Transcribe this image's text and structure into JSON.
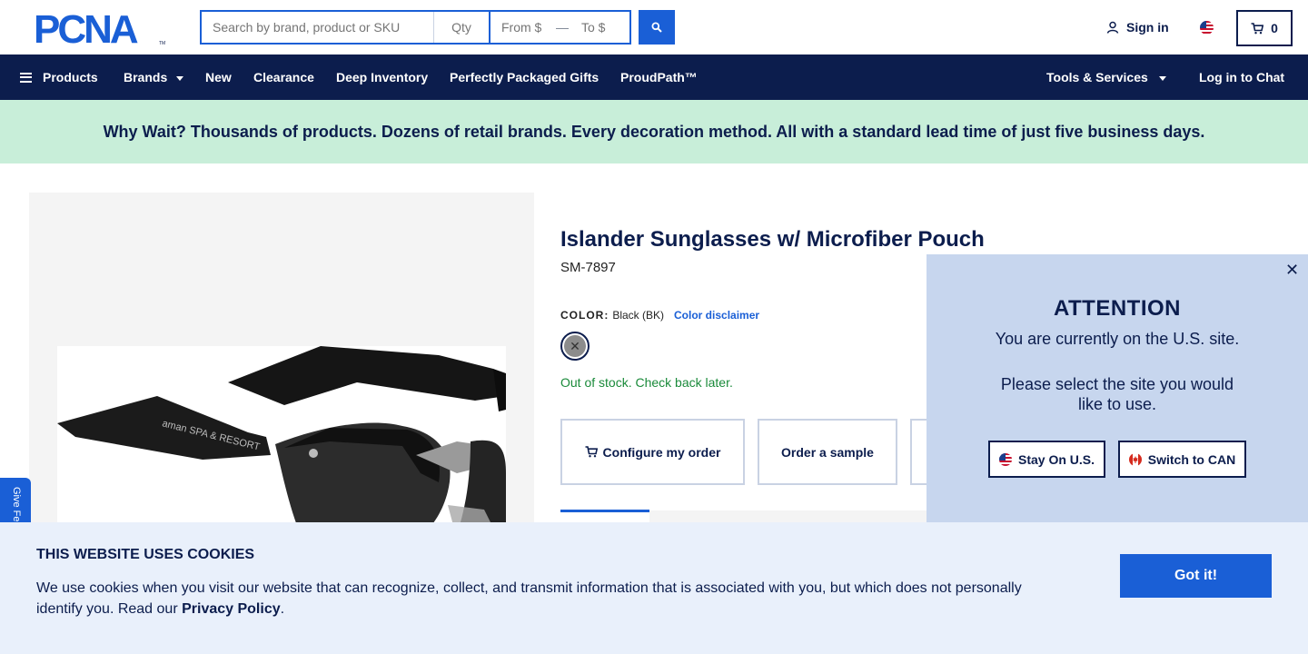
{
  "header": {
    "logo_text": "PCNA",
    "search": {
      "placeholder": "Search by brand, product or SKU"
    },
    "qty": {
      "placeholder": "Qty"
    },
    "price_from": {
      "placeholder": "From $"
    },
    "price_to": {
      "placeholder": "To $"
    },
    "price_separator": "—",
    "sign_in_label": "Sign in",
    "cart_count": "0"
  },
  "nav": {
    "items": [
      {
        "label": "Products",
        "icon": "hamburger-icon"
      },
      {
        "label": "Brands",
        "dropdown": true
      },
      {
        "label": "New"
      },
      {
        "label": "Clearance"
      },
      {
        "label": "Deep Inventory"
      },
      {
        "label": "Perfectly Packaged Gifts"
      },
      {
        "label": "ProudPath™"
      }
    ],
    "right_items": [
      {
        "label": "Tools & Services",
        "dropdown": true
      },
      {
        "label": "Log in to Chat"
      }
    ]
  },
  "banner": {
    "text": "Why Wait? Thousands of products. Dozens of retail brands. Every decoration method. All with a standard lead time of just five business days."
  },
  "feedback_tab": {
    "label": "Give Fe"
  },
  "product": {
    "title": "Islander Sunglasses w/ Microfiber Pouch",
    "sku": "SM-7897",
    "color_label": "COLOR:",
    "color_value": "Black (BK)",
    "color_disclaimer": "Color disclaimer",
    "swatch_color": "#8c8c8c",
    "stock_status": "Out of stock. Check back later.",
    "imprint_text": "aman SPA & RESORT",
    "actions": [
      {
        "label": "Configure my order",
        "icon": "cart-icon"
      },
      {
        "label": "Order a sample"
      }
    ]
  },
  "attention_modal": {
    "title": "ATTENTION",
    "line1": "You are currently on the U.S. site.",
    "line2": "Please select the site you would like to use.",
    "stay_label": "Stay On U.S.",
    "switch_label": "Switch to CAN",
    "close_icon": "close-icon"
  },
  "cookie_bar": {
    "title": "THIS WEBSITE USES COOKIES",
    "text": "We use cookies when you visit our website that can recognize, collect, and transmit information that is associated with you, but which does not personally identify you. Read our ",
    "link": "Privacy Policy",
    "suffix": ".",
    "button": "Got it!"
  },
  "colors": {
    "navy": "#0c1d4d",
    "blue": "#1a5fd6",
    "banner_bg": "#c8eed9",
    "modal_bg": "#c7d6ee",
    "cookie_bg": "#e9f0fb",
    "stock_green": "#1a8a3a"
  }
}
